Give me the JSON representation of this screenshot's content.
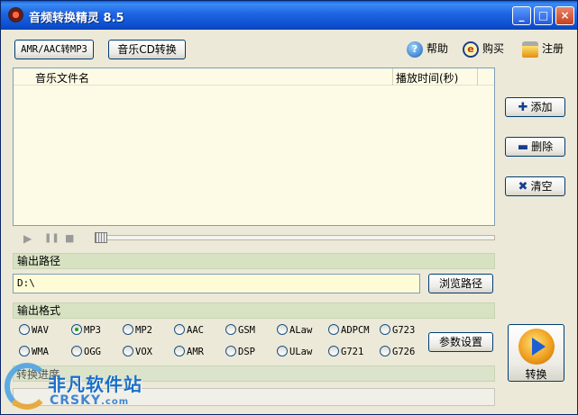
{
  "window": {
    "title": "音频转换精灵 8.5",
    "min_label": "_",
    "max_label": "□",
    "close_label": "×"
  },
  "toolbar": {
    "amr_button": "AMR/AAC转MP3",
    "cd_button": "音乐CD转换",
    "help": "帮助",
    "buy": "购买",
    "register": "注册"
  },
  "file_list": {
    "col_name": "音乐文件名",
    "col_time": "播放时间(秒)",
    "rows": []
  },
  "side_buttons": {
    "add": "添加",
    "delete": "删除",
    "clear": "清空"
  },
  "player": {
    "play": "▶",
    "pause": "❚❚",
    "stop": "■"
  },
  "output_path": {
    "label": "输出路径",
    "value": "D:\\",
    "browse": "浏览路径"
  },
  "output_format": {
    "label": "输出格式",
    "selected": "MP3",
    "options_row1": [
      "WAV",
      "MP3",
      "MP2",
      "AAC",
      "GSM",
      "ALaw",
      "ADPCM",
      "G723"
    ],
    "options_row2": [
      "WMA",
      "OGG",
      "VOX",
      "AMR",
      "DSP",
      "ULaw",
      "G721",
      "G726"
    ],
    "params_button": "参数设置"
  },
  "convert": {
    "label": "转换"
  },
  "progress": {
    "label": "转换进度",
    "value": 0
  },
  "watermark": {
    "cn": "非凡软件站",
    "en": "CRSKY",
    "en_suffix": ".com"
  }
}
